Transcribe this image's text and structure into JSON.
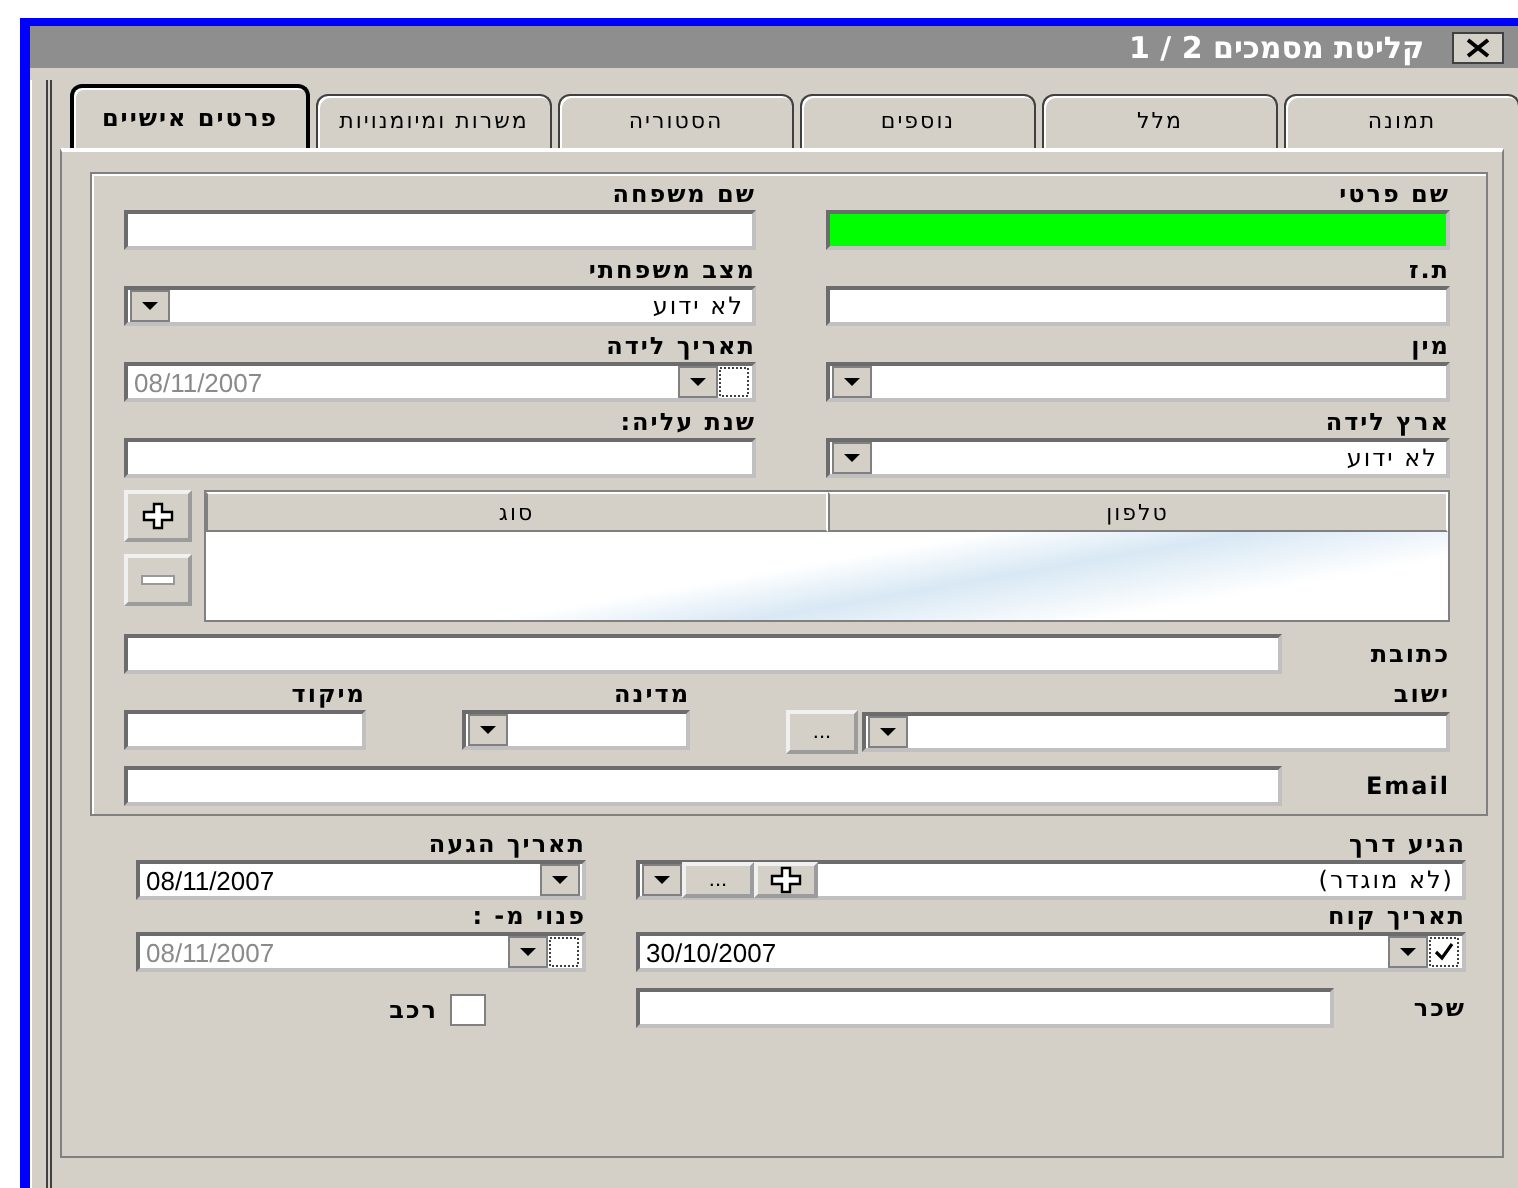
{
  "window": {
    "title": "קליטת מסמכים 2 / 1"
  },
  "tabs": [
    {
      "label": "תמונה",
      "selected": false
    },
    {
      "label": "מלל",
      "selected": false
    },
    {
      "label": "נוספים",
      "selected": false
    },
    {
      "label": "הסטוריה",
      "selected": false
    },
    {
      "label": "משרות ומיומנויות",
      "selected": false
    },
    {
      "label": "פרטים אישיים",
      "selected": true
    }
  ],
  "personal_fields": [
    {
      "kind": "text",
      "label": "שם פרטי",
      "highlighted": true
    },
    {
      "kind": "text",
      "label": "שם משפחה",
      "highlighted": false
    },
    {
      "kind": "text",
      "label": "ת.ז",
      "highlighted": false
    },
    {
      "kind": "combo",
      "label": "מצב משפחתי",
      "value": "לא ידוע"
    },
    {
      "kind": "combo",
      "label": "מין"
    },
    {
      "kind": "date",
      "label": "תאריך לידה",
      "value": "08/11/2007",
      "checked": false
    },
    {
      "kind": "combo",
      "label": "ארץ לידה",
      "value": "לא ידוע"
    },
    {
      "kind": "text",
      "label": "שנת עליה:",
      "highlighted": false
    }
  ],
  "phones": {
    "columns": [
      "טלפון",
      "סוג"
    ]
  },
  "address": {
    "label": "כתובת"
  },
  "location": [
    {
      "kind": "combo_browse",
      "label": "ישוב",
      "browse": "..."
    },
    {
      "kind": "combo",
      "label": "מדינה"
    },
    {
      "kind": "text",
      "label": "מיקוד"
    }
  ],
  "email": {
    "label": "Email"
  },
  "employment_fields": [
    {
      "kind": "combo_add",
      "label": "הגיע דרך",
      "value": "(לא מוגדר)",
      "browse": "..."
    },
    {
      "kind": "date",
      "label": "תאריך הגעה",
      "value": "08/11/2007"
    },
    {
      "kind": "date",
      "label": "תאריך קוח",
      "value": "30/10/2007",
      "checked": true
    },
    {
      "kind": "date",
      "label": "פנוי מ- :",
      "value": "08/11/2007",
      "checked": false
    }
  ],
  "salary": {
    "label": "שכר"
  },
  "car": {
    "label": "רכב",
    "checked": false
  }
}
